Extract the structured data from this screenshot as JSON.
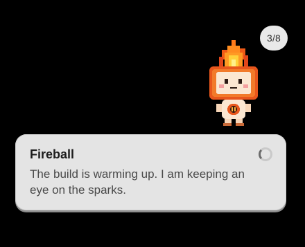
{
  "status": {
    "counter": "3/8"
  },
  "mascot": {
    "icon": "fire-mascot-icon"
  },
  "notification": {
    "title": "Fireball",
    "message": "The build is warming up. I am keeping an eye on the sparks.",
    "spinner_icon": "loading-spinner-icon"
  }
}
